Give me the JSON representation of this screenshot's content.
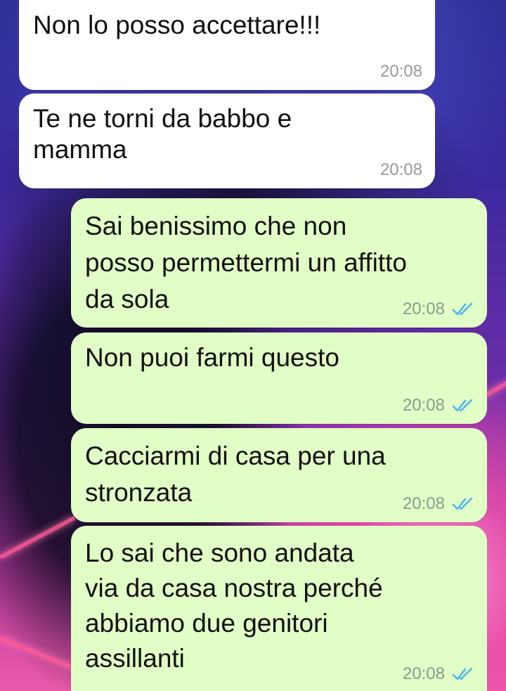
{
  "messages": [
    {
      "direction": "in",
      "text": "Non lo posso accettare!!!",
      "time": "20:08"
    },
    {
      "direction": "in",
      "text": "Te ne torni da babbo e\nmamma",
      "time": "20:08"
    },
    {
      "direction": "out",
      "text": "Sai benissimo che non\nposso permettermi un affitto\nda sola",
      "time": "20:08",
      "status": "read"
    },
    {
      "direction": "out",
      "text": "Non puoi farmi questo",
      "time": "20:08",
      "status": "read"
    },
    {
      "direction": "out",
      "text": "Cacciarmi di casa per una\nstronzata",
      "time": "20:08",
      "status": "read"
    },
    {
      "direction": "out",
      "text": "Lo sai che sono andata\nvia da casa nostra perché\nabbiamo due genitori\nassillanti",
      "time": "20:08",
      "status": "read"
    }
  ],
  "colors": {
    "incoming_bubble": "#ffffff",
    "outgoing_bubble": "#e1fec6",
    "read_ticks": "#4fb6ec",
    "time_text": "#8c9a8c"
  },
  "icons": {
    "read_status": "double-check-icon"
  }
}
